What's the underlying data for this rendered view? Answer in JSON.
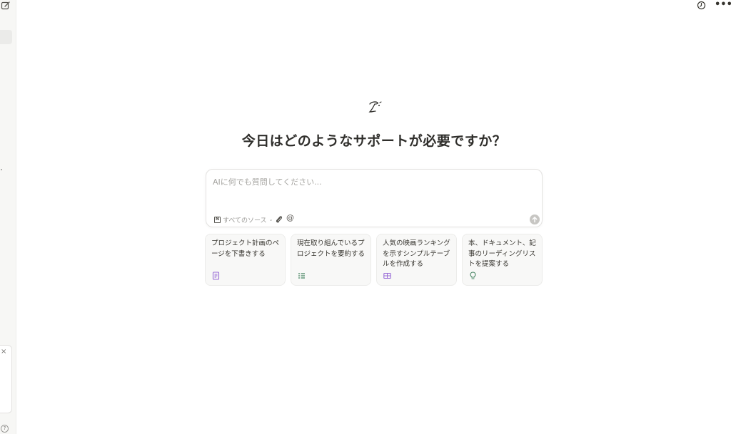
{
  "headline": "今日はどのようなサポートが必要ですか？",
  "input": {
    "placeholder": "AIに何でも質問してください..."
  },
  "toolbar": {
    "sources_label": "すべてのソース",
    "mention_label": "@"
  },
  "suggestions": [
    {
      "text": "プロジェクト計画のページを下書きする",
      "icon": "page-icon",
      "color": "#9a6dd7"
    },
    {
      "text": "現在取り組んでいるプロジェクトを要約する",
      "icon": "list-icon",
      "color": "#448361"
    },
    {
      "text": "人気の映画ランキングを示すシンプルテーブルを作成する",
      "icon": "table-icon",
      "color": "#9a6dd7"
    },
    {
      "text": "本、ドキュメント、記事のリーディングリストを提案する",
      "icon": "lightbulb-icon",
      "color": "#448361"
    }
  ],
  "sidebar": {
    "panel_close": "×",
    "help": "?"
  },
  "colors": {
    "accent_purple": "#9a6dd7",
    "accent_green": "#448361",
    "send_disabled": "#c7c6c3"
  }
}
